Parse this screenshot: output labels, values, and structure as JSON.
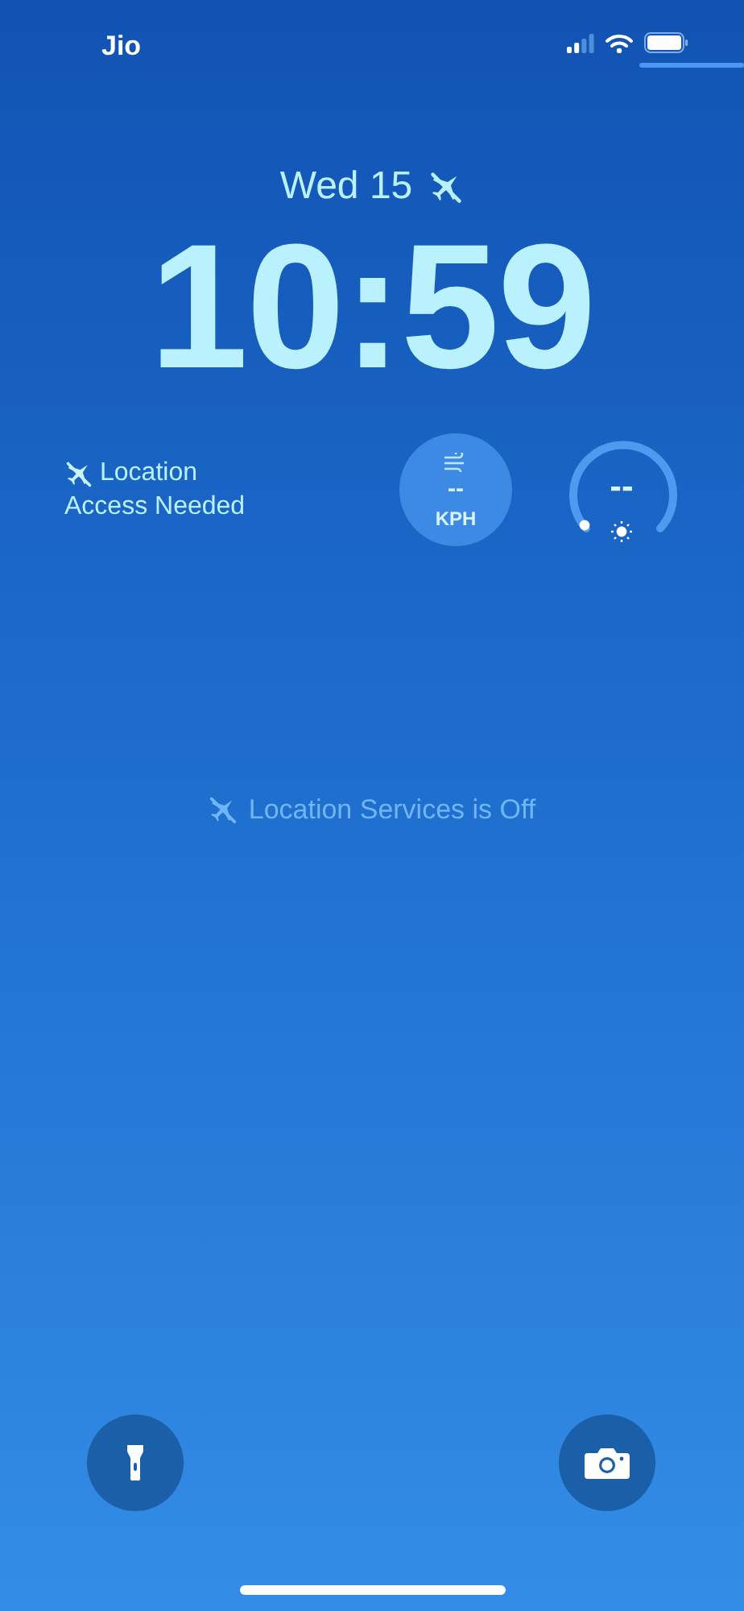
{
  "status_bar": {
    "carrier": "Jio"
  },
  "date": "Wed 15",
  "time": "10:59",
  "widgets": [
    {
      "kind": "text",
      "lines": [
        "Location",
        "Access Needed"
      ]
    },
    {
      "kind": "wind",
      "value": "--",
      "unit": "KPH"
    },
    {
      "kind": "gauge",
      "value": "--"
    }
  ],
  "notice": "Location Services is Off",
  "quick_actions": [
    {
      "kind": "flashlight"
    },
    {
      "kind": "camera"
    }
  ]
}
